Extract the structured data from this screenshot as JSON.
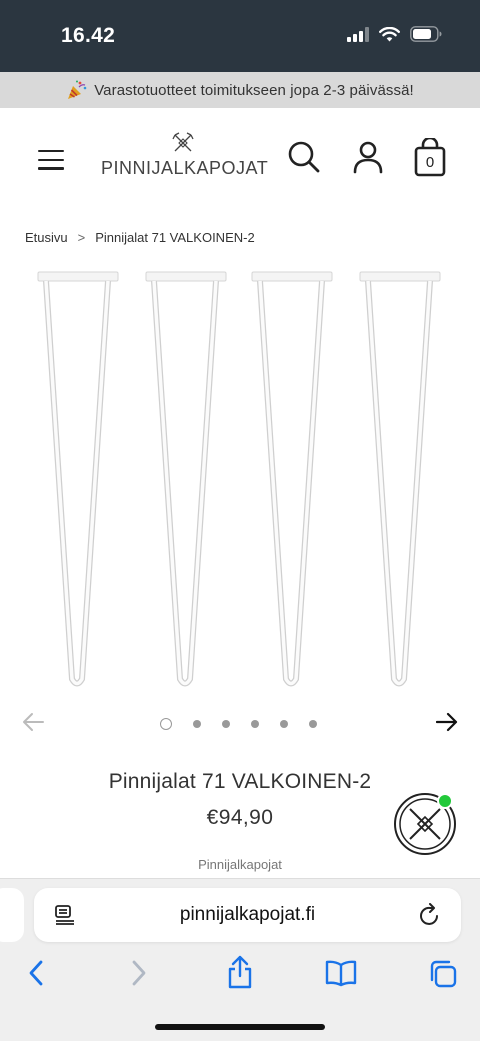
{
  "status_bar": {
    "time": "16.42",
    "icons": [
      "cellular-icon",
      "wifi-icon",
      "battery-icon"
    ]
  },
  "promo": {
    "icon": "party-popper-icon",
    "text": "Varastotuotteet toimitukseen jopa 2-3 päivässä!"
  },
  "header": {
    "logo_text": "PINNIJALKAPOJAT",
    "cart_count": "0",
    "icons": [
      "menu-icon",
      "search-icon",
      "account-icon",
      "cart-icon"
    ]
  },
  "breadcrumb": {
    "home": "Etusivu",
    "separator": ">",
    "current": "Pinnijalat 71 VALKOINEN-2"
  },
  "gallery": {
    "image_subject": "four white hairpin table legs",
    "dots_total": 6,
    "active_dot": 1
  },
  "product": {
    "title": "Pinnijalat 71 VALKOINEN-2",
    "price": "€94,90",
    "vendor": "Pinnijalkapojat"
  },
  "browser": {
    "url": "pinnijalkapojat.fi",
    "toolbar": [
      "back-icon",
      "forward-icon",
      "share-icon",
      "bookmarks-icon",
      "tabs-icon"
    ]
  },
  "colors": {
    "status_bar_bg": "#2b3640",
    "promo_bg": "#d9d9d9",
    "accent_blue": "#1a73e8",
    "online_green": "#22c93a"
  }
}
